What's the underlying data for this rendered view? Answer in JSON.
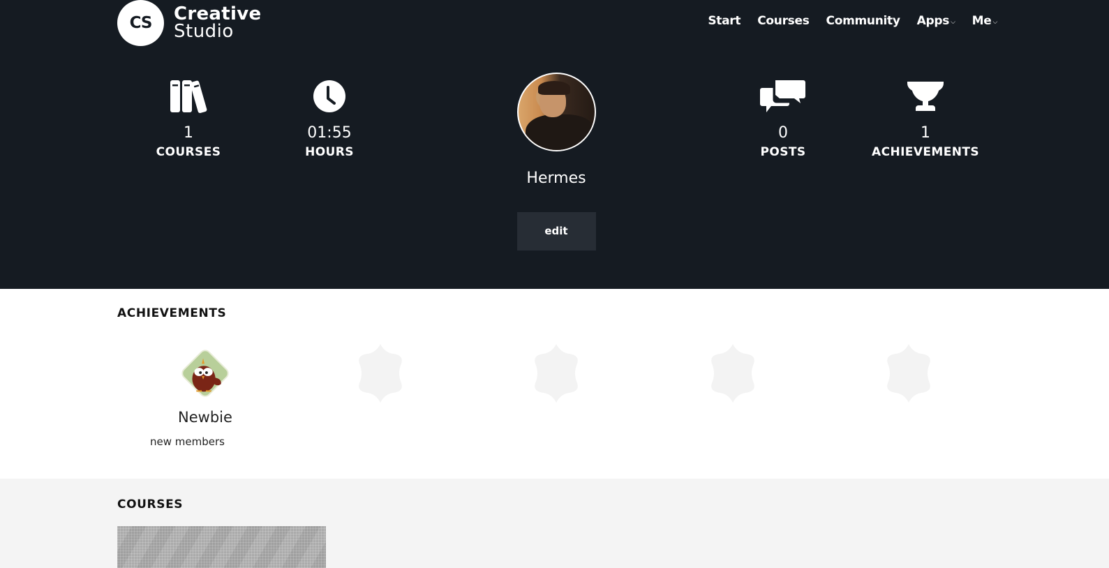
{
  "brand": {
    "initials": "CS",
    "line1": "Creative",
    "line2": "Studio"
  },
  "nav": [
    {
      "label": "Start",
      "dropdown": false
    },
    {
      "label": "Courses",
      "dropdown": false
    },
    {
      "label": "Community",
      "dropdown": false
    },
    {
      "label": "Apps",
      "dropdown": true
    },
    {
      "label": "Me",
      "dropdown": true
    }
  ],
  "nav_chevron": "⌵",
  "stats": {
    "courses": {
      "icon": "books-icon",
      "value": "1",
      "label": "COURSES"
    },
    "hours": {
      "icon": "clock-icon",
      "value": "01:55",
      "label": "HOURS"
    },
    "posts": {
      "icon": "chat-bubbles-icon",
      "value": "0",
      "label": "POSTS"
    },
    "achievements": {
      "icon": "trophy-icon",
      "value": "1",
      "label": "ACHIEVEMENTS"
    }
  },
  "profile": {
    "name": "Hermes",
    "edit_label": "edit"
  },
  "achievements_section": {
    "title": "ACHIEVEMENTS",
    "badges": [
      {
        "name": "Newbie",
        "description": "new members",
        "earned": true,
        "icon": "owl-badge-icon"
      },
      {
        "earned": false,
        "icon": "locked-badge-icon"
      },
      {
        "earned": false,
        "icon": "locked-badge-icon"
      },
      {
        "earned": false,
        "icon": "locked-badge-icon"
      },
      {
        "earned": false,
        "icon": "locked-badge-icon"
      }
    ]
  },
  "courses_section": {
    "title": "COURSES"
  },
  "colors": {
    "hero_bg": "#151b22",
    "edit_bg": "#272d35",
    "locked_badge": "#f3f3f3",
    "badge_green": "#b8cf9a",
    "owl_brown": "#7a2516"
  }
}
